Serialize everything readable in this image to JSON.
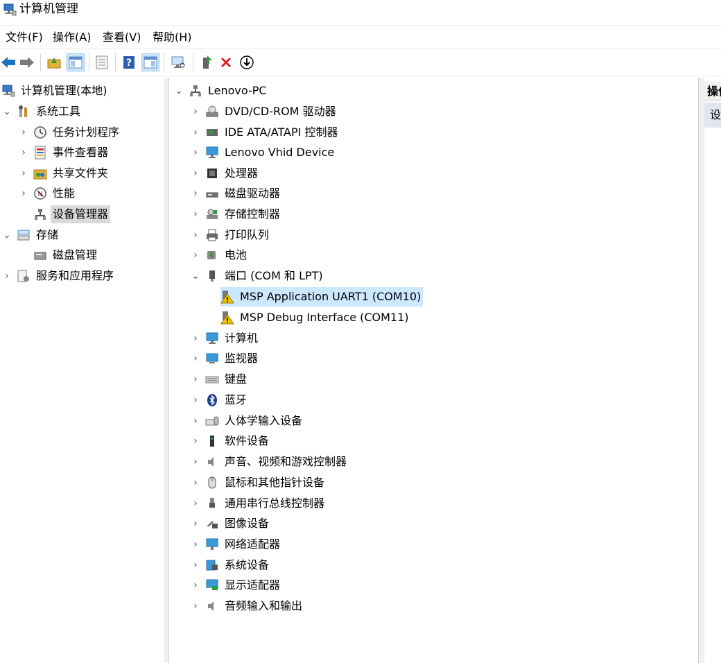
{
  "window": {
    "title": "计算机管理"
  },
  "menu": [
    "文件(F)",
    "操作(A)",
    "查看(V)",
    "帮助(H)"
  ],
  "toolbar": {
    "buttons": [
      {
        "name": "back-button",
        "icon": "arrow-left-icon",
        "color": "#1e73be"
      },
      {
        "name": "forward-button",
        "icon": "arrow-right-icon",
        "color": "#7a7a7a"
      },
      {
        "name": "up-folder-button",
        "icon": "folder-up-icon",
        "color": "#e2b23a"
      },
      {
        "name": "show-hide-console-tree-button",
        "icon": "console-tree-icon",
        "color": "#5b8cc8"
      },
      {
        "name": "export-list-button",
        "icon": "list-icon",
        "color": "#8a8a8a"
      },
      {
        "name": "help-button",
        "icon": "help-icon",
        "color": "#2f5db3"
      },
      {
        "name": "show-action-pane-button",
        "icon": "action-pane-icon",
        "color": "#5b8cc8"
      },
      {
        "name": "scan-hardware-button",
        "icon": "monitor-scan-icon",
        "color": "#4f88c6"
      },
      {
        "name": "update-driver-button",
        "icon": "update-driver-icon",
        "color": "#2e9b3f"
      },
      {
        "name": "uninstall-device-button",
        "icon": "red-x-icon",
        "color": "#e01c1c"
      },
      {
        "name": "disable-device-button",
        "icon": "down-arrow-circle-icon",
        "color": "#000000"
      }
    ]
  },
  "left_tree": [
    {
      "label": "计算机管理(本地)",
      "icon": "computer-management-icon",
      "expander": "none"
    },
    {
      "label": "系统工具",
      "icon": "system-tools-icon",
      "expander": "expanded"
    },
    {
      "label": "任务计划程序",
      "icon": "clock-icon",
      "expander": "collapsed"
    },
    {
      "label": "事件查看器",
      "icon": "event-viewer-icon",
      "expander": "collapsed"
    },
    {
      "label": "共享文件夹",
      "icon": "shared-folder-icon",
      "expander": "collapsed"
    },
    {
      "label": "性能",
      "icon": "performance-icon",
      "expander": "collapsed"
    },
    {
      "label": "设备管理器",
      "icon": "device-manager-icon",
      "expander": "none",
      "selected": true
    },
    {
      "label": "存储",
      "icon": "storage-icon",
      "expander": "expanded"
    },
    {
      "label": "磁盘管理",
      "icon": "disk-management-icon",
      "expander": "none"
    },
    {
      "label": "服务和应用程序",
      "icon": "services-icon",
      "expander": "collapsed"
    }
  ],
  "device_tree": {
    "root": "Lenovo-PC",
    "categories": [
      {
        "label": "DVD/CD-ROM 驱动器",
        "icon": "dvd-drive-icon"
      },
      {
        "label": "IDE ATA/ATAPI 控制器",
        "icon": "ide-controller-icon"
      },
      {
        "label": "Lenovo Vhid Device",
        "icon": "vhid-device-icon"
      },
      {
        "label": "处理器",
        "icon": "processor-icon"
      },
      {
        "label": "磁盘驱动器",
        "icon": "disk-drive-icon"
      },
      {
        "label": "存储控制器",
        "icon": "storage-controller-icon"
      },
      {
        "label": "打印队列",
        "icon": "printer-icon"
      },
      {
        "label": "电池",
        "icon": "battery-icon"
      },
      {
        "label": "端口 (COM 和 LPT)",
        "icon": "port-icon",
        "expanded": true,
        "children": [
          {
            "label": "MSP Application UART1 (COM10)",
            "icon": "warning-device-icon",
            "highlight": true
          },
          {
            "label": "MSP Debug Interface (COM11)",
            "icon": "warning-device-icon"
          }
        ]
      },
      {
        "label": "计算机",
        "icon": "computer-icon"
      },
      {
        "label": "监视器",
        "icon": "monitor-icon"
      },
      {
        "label": "键盘",
        "icon": "keyboard-icon"
      },
      {
        "label": "蓝牙",
        "icon": "bluetooth-icon"
      },
      {
        "label": "人体学输入设备",
        "icon": "hid-icon"
      },
      {
        "label": "软件设备",
        "icon": "software-device-icon"
      },
      {
        "label": "声音、视频和游戏控制器",
        "icon": "speaker-icon"
      },
      {
        "label": "鼠标和其他指针设备",
        "icon": "mouse-icon"
      },
      {
        "label": "通用串行总线控制器",
        "icon": "usb-icon"
      },
      {
        "label": "图像设备",
        "icon": "camera-icon"
      },
      {
        "label": "网络适配器",
        "icon": "network-adapter-icon"
      },
      {
        "label": "系统设备",
        "icon": "system-device-icon"
      },
      {
        "label": "显示适配器",
        "icon": "display-adapter-icon"
      },
      {
        "label": "音频输入和输出",
        "icon": "audio-io-icon"
      }
    ]
  },
  "actions_pane": {
    "header": "操作",
    "item": "设备管理器"
  }
}
